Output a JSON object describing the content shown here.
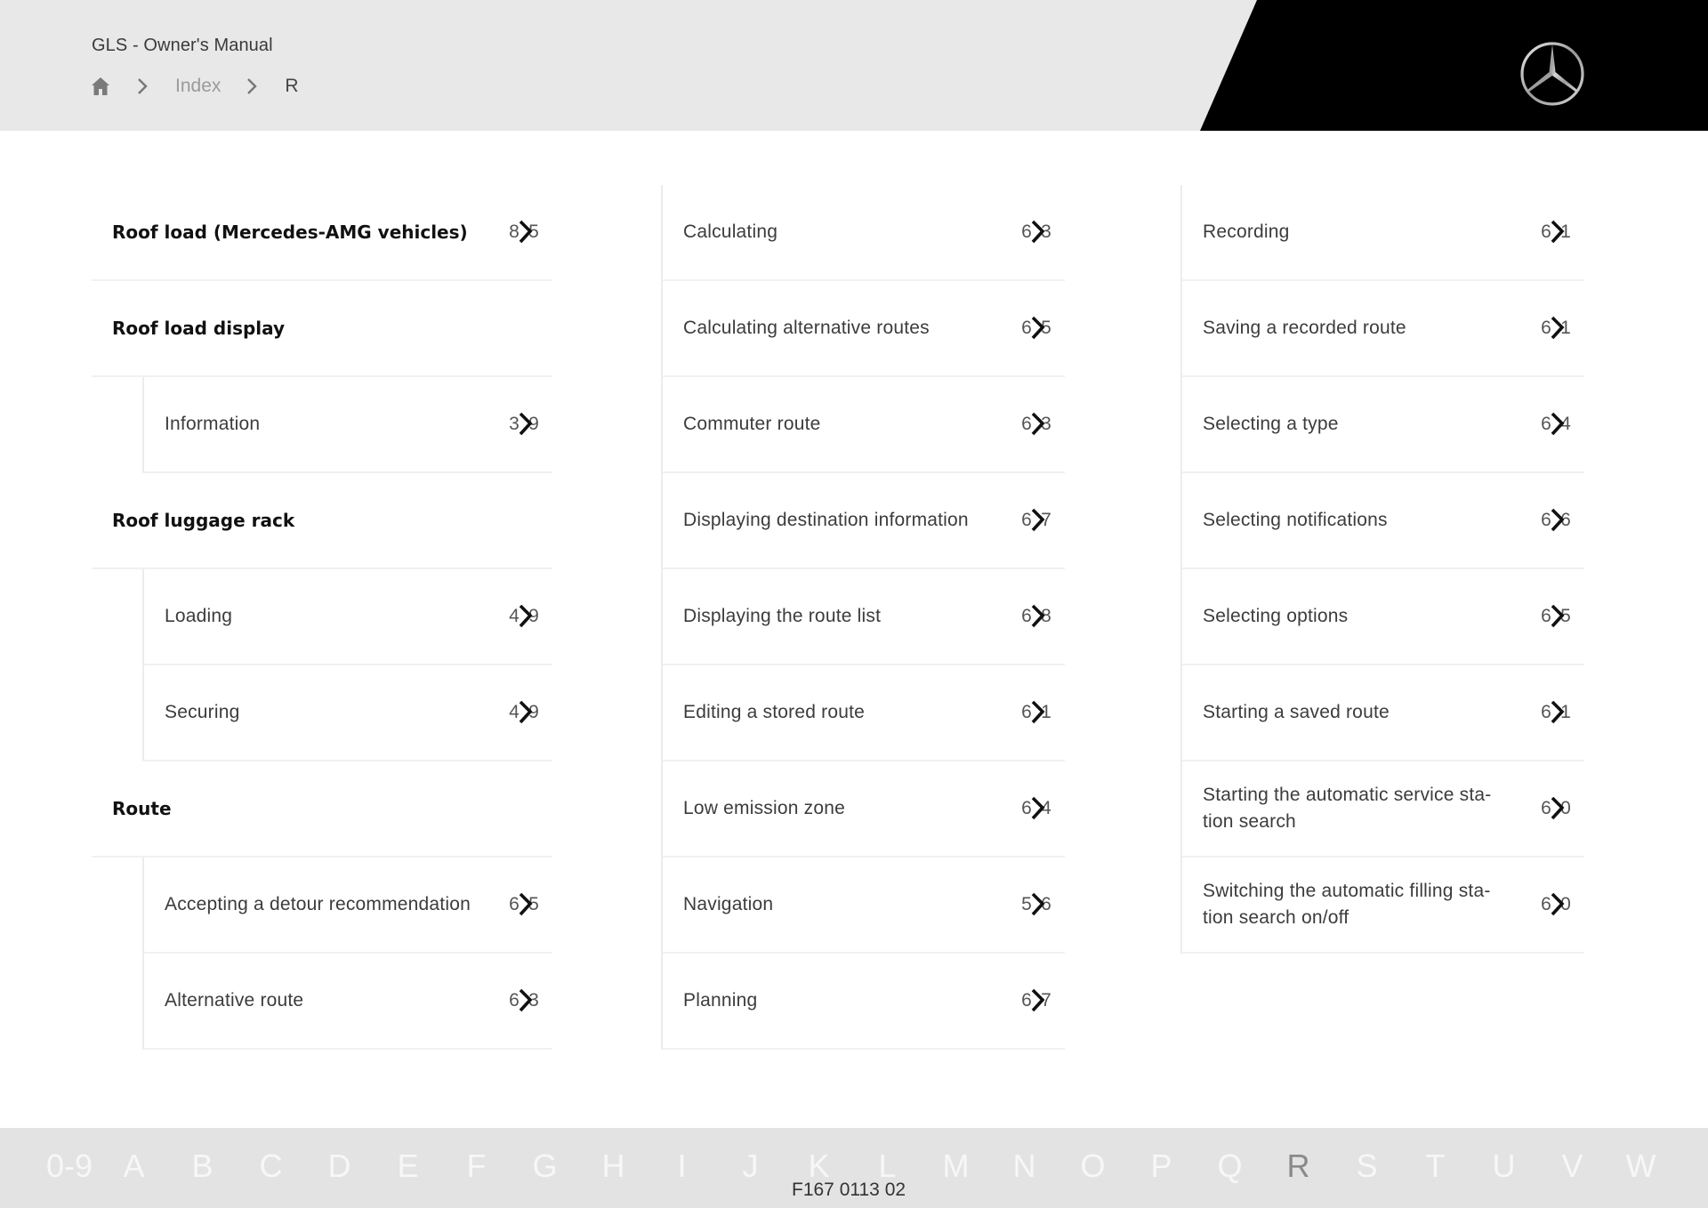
{
  "header": {
    "title": "GLS - Owner's Manual",
    "breadcrumb": {
      "home_icon": "home-icon",
      "separator_icon": "chevron-right-icon",
      "items": [
        "Index",
        "R"
      ]
    },
    "logo": "mercedes-star-logo"
  },
  "columns": {
    "left": [
      {
        "type": "heading",
        "label": "Roof load (Mercedes-AMG vehicles)",
        "page_visible": [
          "8",
          "5"
        ]
      },
      {
        "type": "heading",
        "label": "Roof load display",
        "page_visible": null
      },
      {
        "type": "sub",
        "label": "Information",
        "page_visible": [
          "3",
          "9"
        ]
      },
      {
        "type": "heading",
        "label": "Roof luggage rack",
        "page_visible": null
      },
      {
        "type": "sub",
        "label": "Loading",
        "page_visible": [
          "4",
          "9"
        ]
      },
      {
        "type": "sub",
        "label": "Securing",
        "page_visible": [
          "4",
          "9"
        ]
      },
      {
        "type": "heading",
        "label": "Route",
        "page_visible": null
      },
      {
        "type": "sub",
        "label": "Accepting a detour recommendation",
        "page_visible": [
          "6",
          "5"
        ]
      },
      {
        "type": "sub",
        "label": "Alternative route",
        "page_visible": [
          "6",
          "3"
        ]
      }
    ],
    "middle": [
      {
        "label": "Calculating",
        "page_visible": [
          "6",
          "3"
        ]
      },
      {
        "label": "Calculating alternative routes",
        "page_visible": [
          "6",
          "5"
        ]
      },
      {
        "label": "Commuter route",
        "page_visible": [
          "6",
          "3"
        ]
      },
      {
        "label": "Displaying destination information",
        "page_visible": [
          "6",
          "7"
        ]
      },
      {
        "label": "Displaying the route list",
        "page_visible": [
          "6",
          "8"
        ]
      },
      {
        "label": "Editing a stored route",
        "page_visible": [
          "6",
          "1"
        ]
      },
      {
        "label": "Low emission zone",
        "page_visible": [
          "6",
          "4"
        ]
      },
      {
        "label": "Navigation",
        "page_visible": [
          "5",
          "6"
        ]
      },
      {
        "label": "Planning",
        "page_visible": [
          "6",
          "7"
        ]
      }
    ],
    "right": [
      {
        "label": "Recording",
        "page_visible": [
          "6",
          "1"
        ]
      },
      {
        "label": "Saving a recorded route",
        "page_visible": [
          "6",
          "1"
        ]
      },
      {
        "label": "Selecting a type",
        "page_visible": [
          "6",
          "4"
        ]
      },
      {
        "label": "Selecting notifications",
        "page_visible": [
          "6",
          "6"
        ]
      },
      {
        "label": "Selecting options",
        "page_visible": [
          "6",
          "5"
        ]
      },
      {
        "label": "Starting a saved route",
        "page_visible": [
          "6",
          "1"
        ]
      },
      {
        "label": "Starting the automatic service sta-\ntion search",
        "page_visible": [
          "6",
          "0"
        ]
      },
      {
        "label": "Switching the automatic filling sta-\ntion search on/off",
        "page_visible": [
          "6",
          "0"
        ]
      }
    ]
  },
  "footer": {
    "alphabet": [
      "0-9",
      "A",
      "B",
      "C",
      "D",
      "E",
      "F",
      "G",
      "H",
      "I",
      "J",
      "K",
      "L",
      "M",
      "N",
      "O",
      "P",
      "Q",
      "R",
      "S",
      "T",
      "U",
      "V",
      "W"
    ],
    "active_letter": "R",
    "doc_code": "F167 0113 02"
  },
  "colors": {
    "header_bg": "#e8e8e8",
    "header_black": "#000000",
    "footer_bg": "#e3e3e3",
    "active_letter": "#8a8a8a",
    "inactive_letter": "#f7f7f7"
  }
}
